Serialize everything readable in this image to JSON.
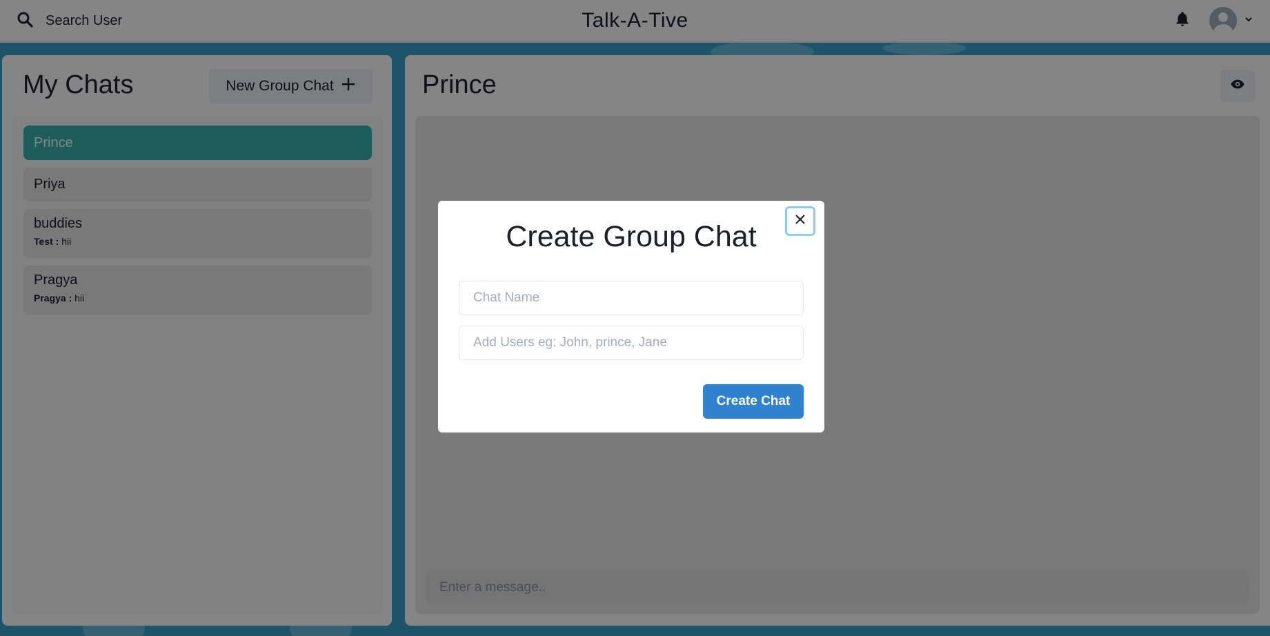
{
  "header": {
    "search_label": "Search User",
    "app_title": "Talk-A-Tive"
  },
  "my_chats": {
    "title": "My Chats",
    "new_group_label": "New Group Chat",
    "items": [
      {
        "name": "Prince",
        "latest_sender": "",
        "latest_text": ""
      },
      {
        "name": "Priya",
        "latest_sender": "",
        "latest_text": ""
      },
      {
        "name": "buddies",
        "latest_sender": "Test :",
        "latest_text": "hii"
      },
      {
        "name": "Pragya",
        "latest_sender": "Pragya :",
        "latest_text": "hii"
      }
    ]
  },
  "chat": {
    "title": "Prince",
    "message_placeholder": "Enter a message.."
  },
  "modal": {
    "title": "Create Group Chat",
    "chat_name_placeholder": "Chat Name",
    "add_users_placeholder": "Add Users eg: John, prince, Jane",
    "create_label": "Create Chat"
  },
  "colors": {
    "active_chat": "#38b2ac",
    "primary_button": "#3182ce",
    "background": "#3a9fc9",
    "focus_ring": "#90cdf4"
  },
  "icons": {
    "search": "search-icon",
    "bell": "bell-icon",
    "avatar": "avatar",
    "chevron": "chevron-down-icon",
    "plus": "plus-icon",
    "eye": "eye-icon",
    "close": "close-icon"
  }
}
